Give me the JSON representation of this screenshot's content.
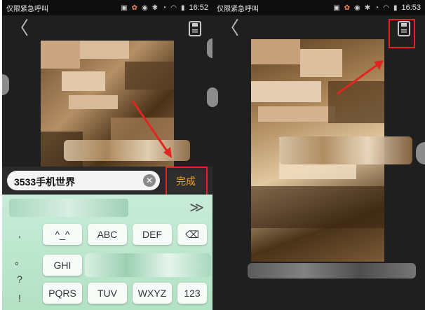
{
  "statusbar": {
    "carrier": "仅限紧急呼叫",
    "left_time": "16:52",
    "right_time": "16:53",
    "icons": [
      "notification-icon",
      "app-icon",
      "weibo-icon",
      "bluetooth-icon",
      "alarm-icon",
      "wifi-icon",
      "battery-icon"
    ]
  },
  "left_screen": {
    "back_glyph": "〈",
    "input_value": "3533手机世界",
    "clear_glyph": "✕",
    "done_label": "完成",
    "keyboard": {
      "chevron": "≫",
      "symbols": [
        ",",
        "。",
        "?",
        "!"
      ],
      "keys_row1": [
        "^_^",
        "ABC",
        "DEF"
      ],
      "keys_row2": [
        "GHI"
      ],
      "keys_row3": [
        "PQRS",
        "TUV",
        "WXYZ",
        "123"
      ],
      "backspace_glyph": "⌫"
    }
  },
  "right_screen": {
    "back_glyph": "〈"
  },
  "colors": {
    "highlight": "#e1261f",
    "done_text": "#f0a020",
    "background": "#1f1f1f",
    "keyboard": "#c7ecd9"
  }
}
